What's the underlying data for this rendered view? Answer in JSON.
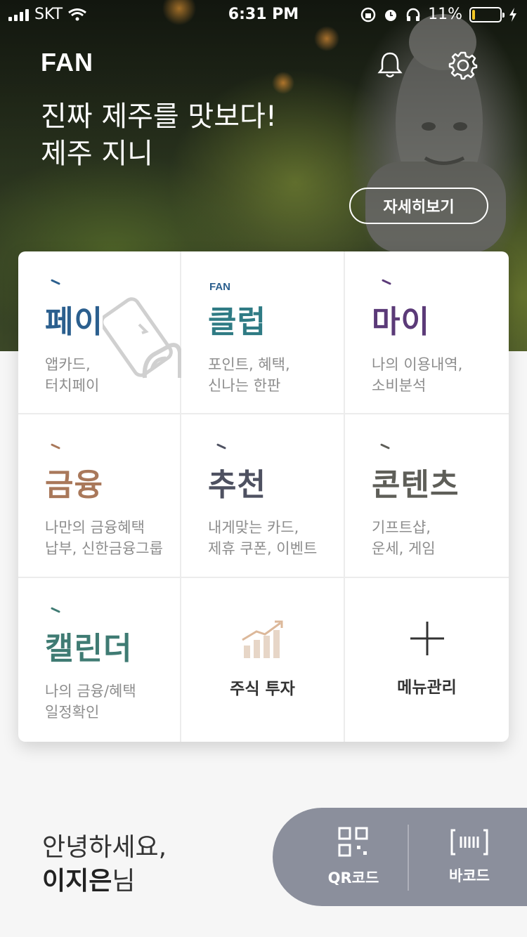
{
  "status": {
    "carrier": "SKT",
    "time": "6:31 PM",
    "battery": "11%",
    "battery_level": 0.11
  },
  "header": {
    "logo": "FAN",
    "title_line1": "진짜 제주를 맛보다!",
    "title_line2": "제주 지니",
    "detail_button": "자세히보기"
  },
  "icons": {
    "bell": "bell-icon",
    "settings": "gear-icon",
    "qr": "qr-code-icon",
    "barcode": "barcode-icon",
    "stock": "chart-up-icon",
    "add": "plus-icon"
  },
  "colors": {
    "pay": "#2b5f8e",
    "club": "#2f7b84",
    "my": "#5b3a78",
    "finance": "#a9785a",
    "recommend": "#4e5161",
    "content": "#5e5e58",
    "calendar": "#3f7b73",
    "code_panel": "#8b8f9c"
  },
  "menu": [
    {
      "key": "pay",
      "title": "페이",
      "desc1": "앱카드,",
      "desc2": "터치페이"
    },
    {
      "key": "club",
      "tag": "FAN",
      "title": "클럽",
      "desc1": "포인트, 혜택,",
      "desc2": "신나는 한판"
    },
    {
      "key": "my",
      "title": "마이",
      "desc1": "나의 이용내역,",
      "desc2": "소비분석"
    },
    {
      "key": "finance",
      "title": "금융",
      "desc1": "나만의 금융혜택",
      "desc2": "납부, 신한금융그룹"
    },
    {
      "key": "recommend",
      "title": "추천",
      "desc1": "내게맞는 카드,",
      "desc2": "제휴 쿠폰, 이벤트"
    },
    {
      "key": "content",
      "title": "콘텐츠",
      "desc1": "기프트샵,",
      "desc2": "운세, 게임"
    },
    {
      "key": "calendar",
      "title": "캘린더",
      "desc1": "나의 금융/혜택",
      "desc2": "일정확인"
    },
    {
      "key": "stock",
      "title": "주식 투자"
    },
    {
      "key": "menu_manage",
      "title": "메뉴관리"
    }
  ],
  "greeting": {
    "line1": "안녕하세요,",
    "name": "이지은",
    "suffix": "님"
  },
  "codes": {
    "qr_label": "QR코드",
    "barcode_label": "바코드"
  }
}
